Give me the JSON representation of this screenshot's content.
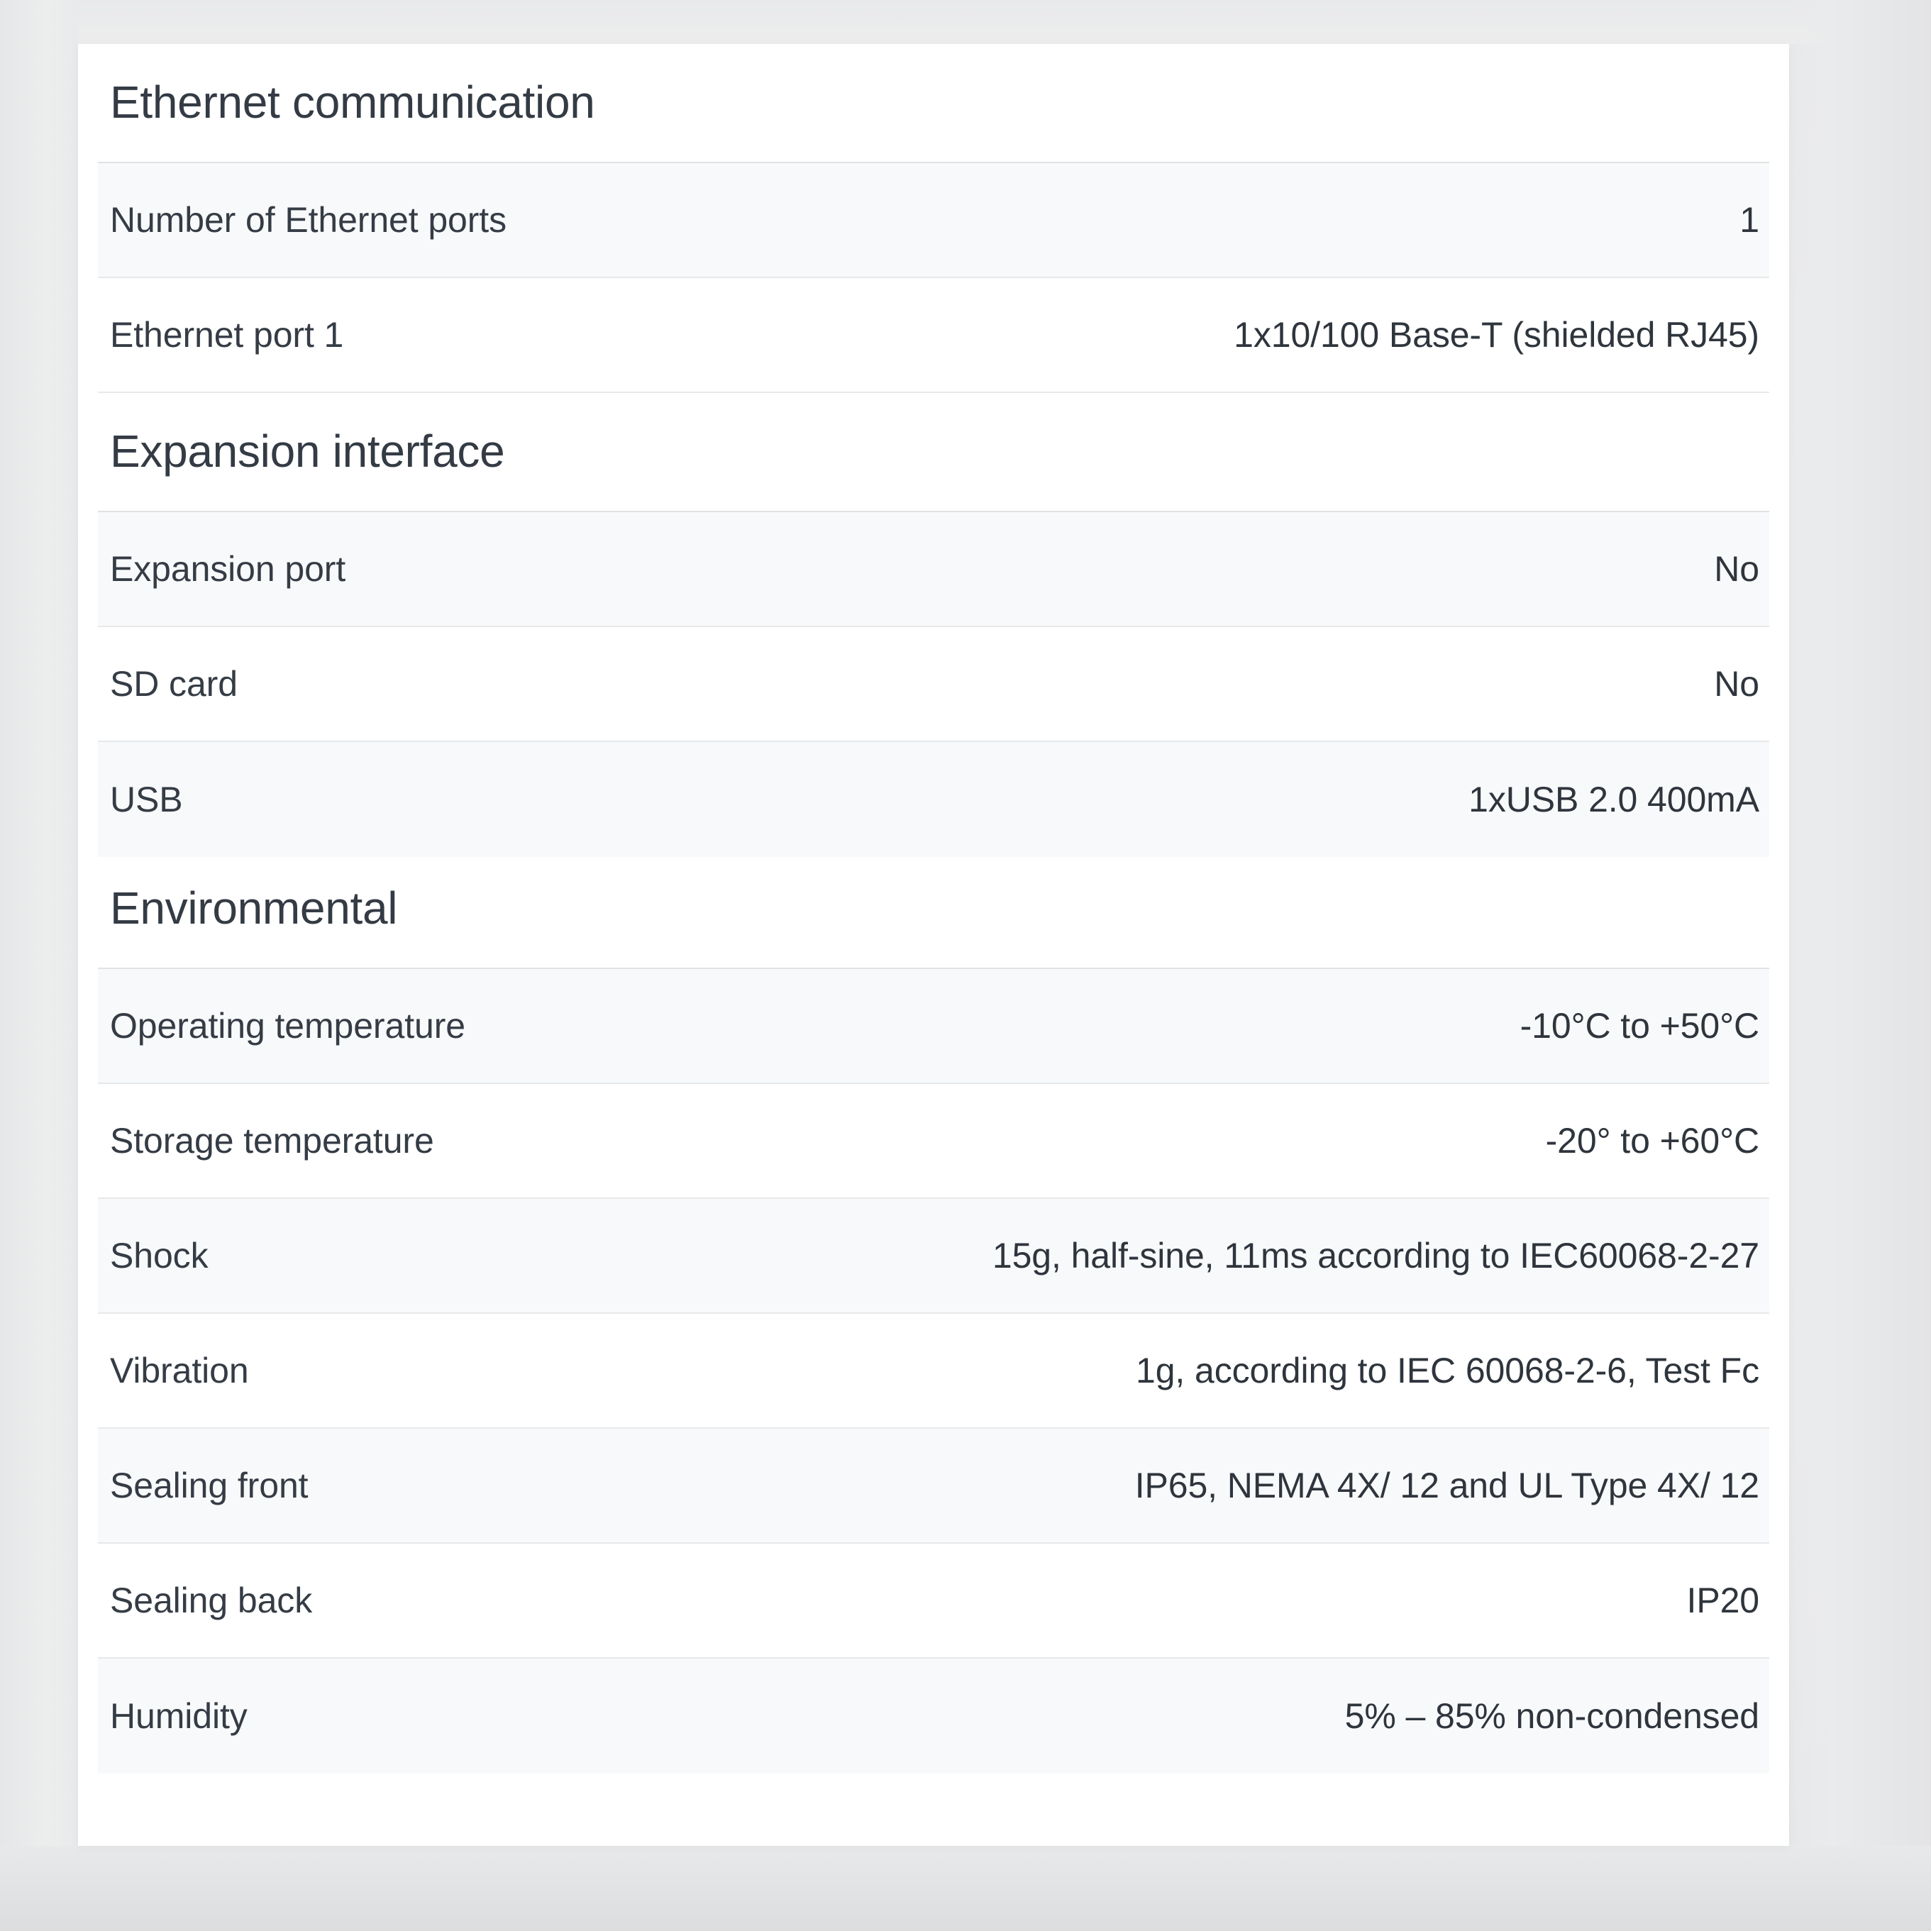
{
  "colors": {
    "card_background": "#ffffff",
    "page_background": "#eaebec",
    "row_shade": "#f8f9fa",
    "divider": "#e6e8ea",
    "text_primary": "#343b44"
  },
  "spec_sheet": {
    "sections": [
      {
        "title": "Ethernet communication",
        "rows": [
          {
            "label": "Number of Ethernet ports",
            "value": "1"
          },
          {
            "label": "Ethernet port 1",
            "value": "1x10/100 Base-T (shielded RJ45)"
          }
        ]
      },
      {
        "title": "Expansion interface",
        "rows": [
          {
            "label": "Expansion port",
            "value": "No"
          },
          {
            "label": "SD card",
            "value": "No"
          },
          {
            "label": "USB",
            "value": "1xUSB 2.0 400mA"
          }
        ]
      },
      {
        "title": "Environmental",
        "rows": [
          {
            "label": "Operating temperature",
            "value": "-10°C to +50°C"
          },
          {
            "label": "Storage temperature",
            "value": "-20° to +60°C"
          },
          {
            "label": "Shock",
            "value": "15g, half-sine, 11ms according to IEC60068-2-27"
          },
          {
            "label": "Vibration",
            "value": "1g, according to IEC 60068-2-6, Test Fc"
          },
          {
            "label": "Sealing front",
            "value": "IP65, NEMA 4X/ 12 and UL Type 4X/ 12"
          },
          {
            "label": "Sealing back",
            "value": "IP20"
          },
          {
            "label": "Humidity",
            "value": "5% – 85% non-condensed"
          }
        ]
      }
    ]
  }
}
